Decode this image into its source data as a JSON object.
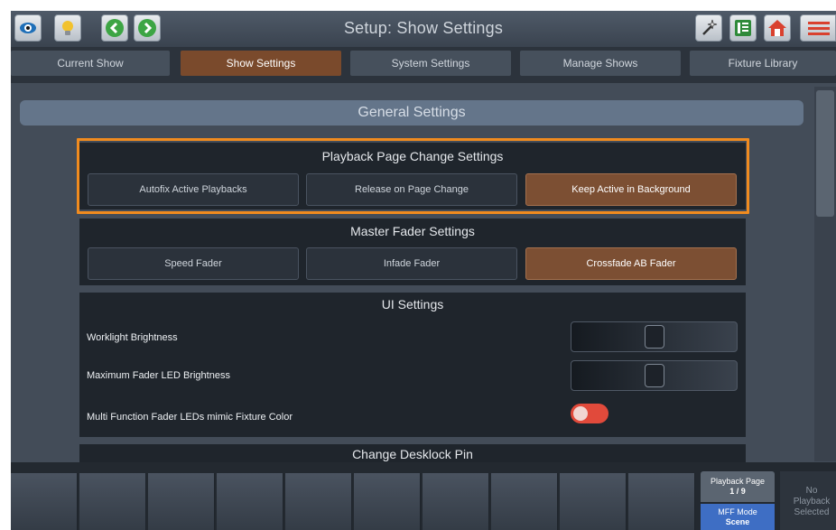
{
  "header": {
    "title": "Setup: Show Settings",
    "left_icons": [
      "eye-icon",
      "lightbulb-icon",
      "back-arrow-icon",
      "forward-arrow-icon"
    ],
    "right_icons": [
      "magic-wand-icon",
      "channel-grid-icon",
      "home-icon",
      "menu-icon"
    ]
  },
  "tabs": [
    {
      "label": "Current Show",
      "active": false
    },
    {
      "label": "Show Settings",
      "active": true
    },
    {
      "label": "System Settings",
      "active": false
    },
    {
      "label": "Manage Shows",
      "active": false
    },
    {
      "label": "Fixture Library",
      "active": false
    }
  ],
  "general_header": "General Settings",
  "playback_section": {
    "title": "Playback Page Change Settings",
    "options": [
      "Autofix Active Playbacks",
      "Release on Page Change",
      "Keep Active in Background"
    ],
    "selected": "Keep Active in Background"
  },
  "master_section": {
    "title": "Master Fader Settings",
    "options": [
      "Speed Fader",
      "Infade Fader",
      "Crossfade AB Fader"
    ],
    "selected": "Crossfade AB Fader"
  },
  "ui_section": {
    "title": "UI Settings",
    "worklight_label": "Worklight Brightness",
    "worklight_level": 0.5,
    "fader_led_label": "Maximum Fader LED Brightness",
    "fader_led_level": 0.5,
    "mff_color_label": "Multi Function Fader LEDs mimic Fixture Color",
    "mff_color_enabled": true
  },
  "desklock_section": {
    "title": "Change Desklock Pin"
  },
  "bottom_bar": {
    "playback_page_label": "Playback Page",
    "playback_page_value": "1 / 9",
    "mff_mode_label": "MFF Mode",
    "mff_mode_value": "Scene",
    "no_playback_line1": "No",
    "no_playback_line2": "Playback",
    "no_playback_line3": "Selected"
  },
  "colors": {
    "accent_selected": "#7c4f33",
    "highlight_outline": "#f08b1f",
    "toggle_on": "#e14a3b",
    "mff_mode": "#3e6ec4"
  }
}
